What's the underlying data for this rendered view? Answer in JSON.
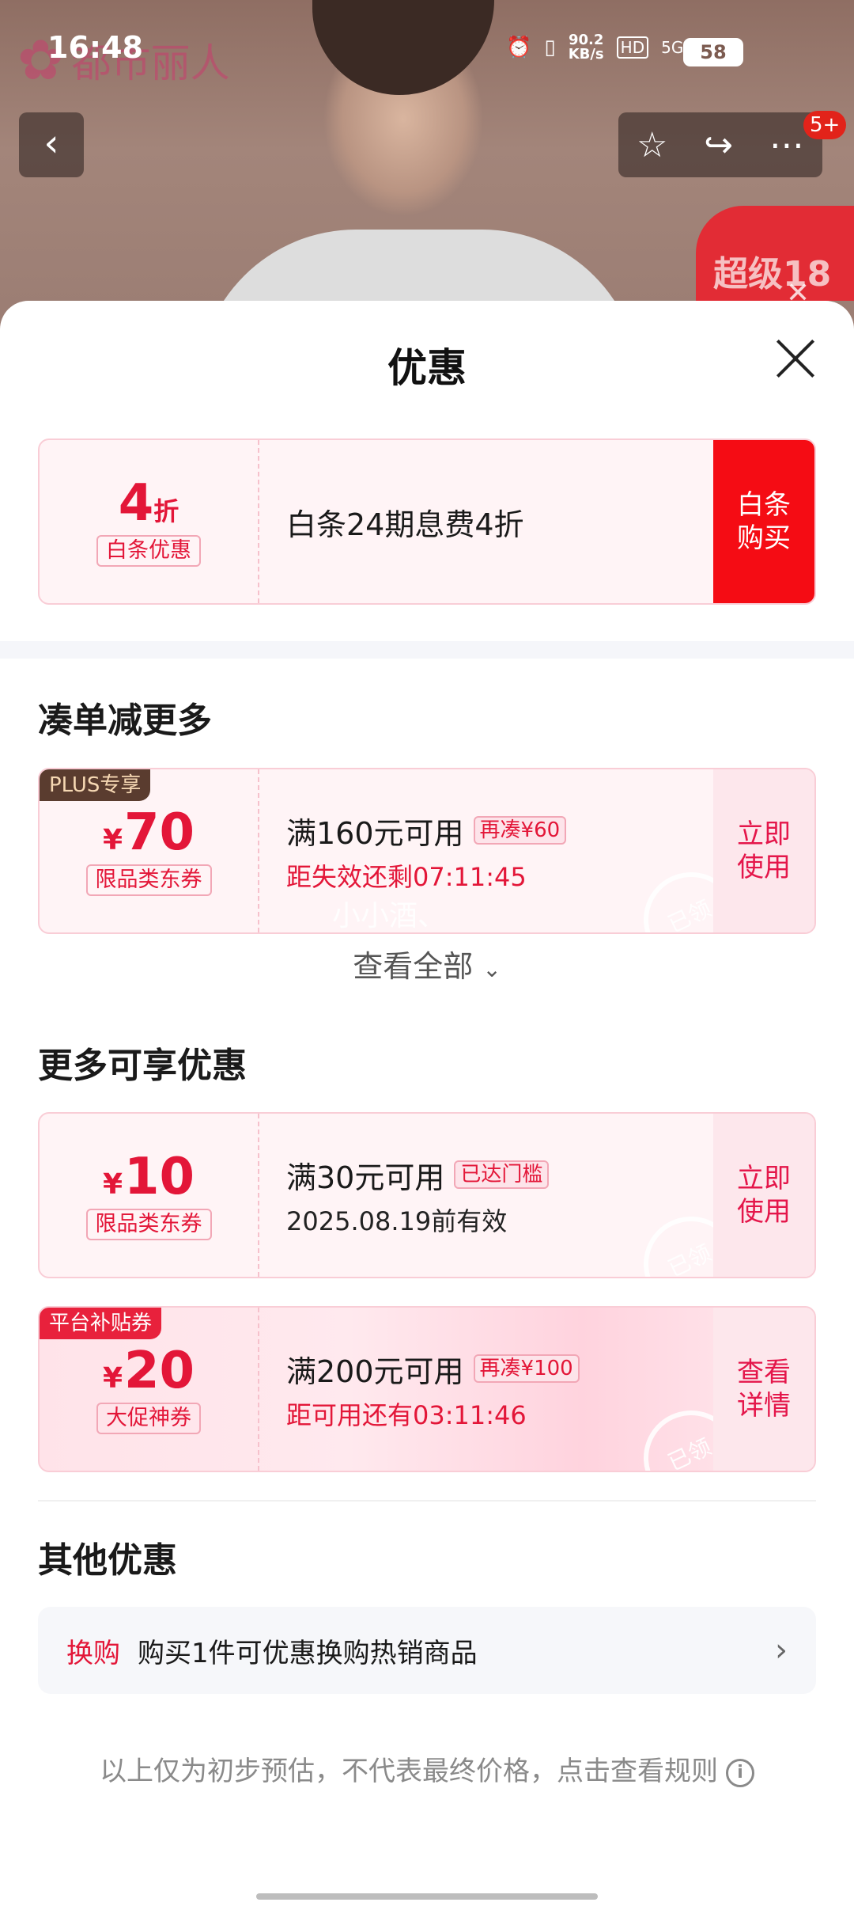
{
  "status_bar": {
    "time": "16:48",
    "net_speed_top": "90.2",
    "net_speed_unit": "KB/s",
    "hd": "HD",
    "network": "5G",
    "battery": "58"
  },
  "background": {
    "brand": "都市丽人",
    "promo_text": "超级18",
    "cart_badge": "5+"
  },
  "sheet": {
    "title": "优惠",
    "baitiao": {
      "amount": "4",
      "unit": "折",
      "tag": "白条优惠",
      "desc": "白条24期息费4折",
      "action_line1": "白条",
      "action_line2": "购买"
    },
    "section1": {
      "title": "凑单减更多",
      "coupon": {
        "corner": "PLUS专享",
        "currency": "¥",
        "amount": "70",
        "tag": "限品类东券",
        "condition": "满160元可用",
        "pill": "再凑¥60",
        "sub": "距失效还剩07:11:45",
        "action_line1": "立即",
        "action_line2": "使用",
        "stamp": "已领"
      },
      "view_all": "查看全部"
    },
    "section2": {
      "title": "更多可享优惠",
      "coupons": [
        {
          "currency": "¥",
          "amount": "10",
          "tag": "限品类东券",
          "condition": "满30元可用",
          "pill": "已达门槛",
          "sub": "2025.08.19前有效",
          "action_line1": "立即",
          "action_line2": "使用",
          "stamp": "已领"
        },
        {
          "corner": "平台补贴券",
          "currency": "¥",
          "amount": "20",
          "tag": "大促神券",
          "condition": "满200元可用",
          "pill": "再凑¥100",
          "sub": "距可用还有03:11:46",
          "action_line1": "查看",
          "action_line2": "详情",
          "stamp": "已领"
        }
      ]
    },
    "section3": {
      "title": "其他优惠",
      "row_tag": "换购",
      "row_text": "购买1件可优惠换购热销商品"
    },
    "disclaimer": "以上仅为初步预估，不代表最终价格，点击查看规则"
  },
  "watermark": "小小酒、",
  "colors": {
    "accent_red": "#e31638",
    "solid_red": "#f50c14",
    "coupon_bg": "#fff4f6"
  }
}
